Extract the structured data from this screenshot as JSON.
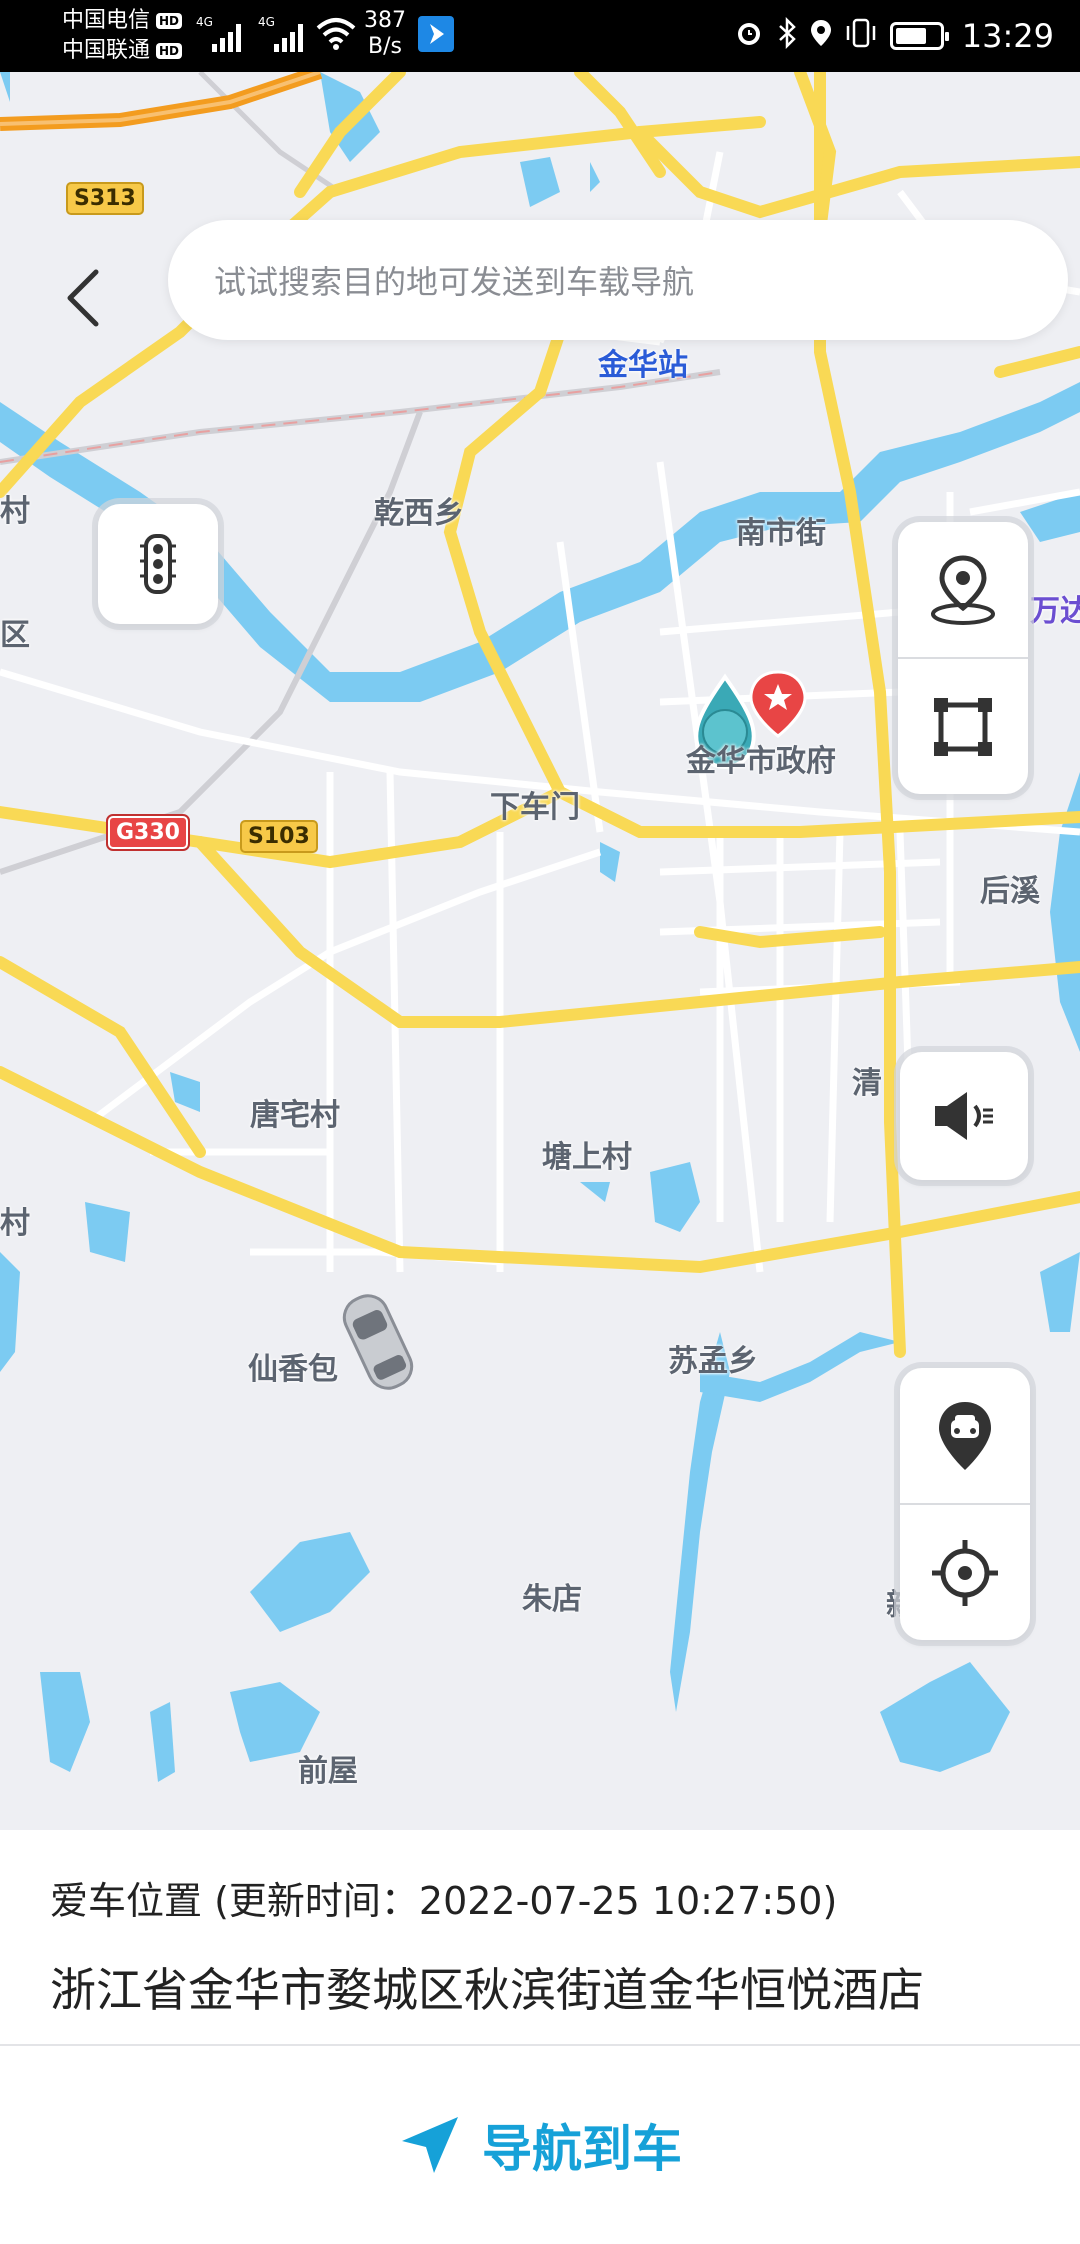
{
  "status_bar": {
    "carrier1": "中国电信",
    "carrier2": "中国联通",
    "hd_badge": "HD",
    "network": "4G",
    "speed_value": "387",
    "speed_unit": "B/s",
    "time": "13:29"
  },
  "search": {
    "placeholder": "试试搜索目的地可发送到车载导航"
  },
  "map": {
    "places": {
      "jinhua_station": "金华站",
      "qianxi": "乾西乡",
      "nanshi_street": "南市街",
      "city_gov": "金华市政府",
      "xiachemen": "下车门",
      "houxi": "后溪",
      "tangzhai": "唐宅村",
      "tangshang": "塘上村",
      "qing": "清",
      "xianxiangbao": "仙香包",
      "sumeng": "苏孟乡",
      "zhudian": "朱店",
      "qianwu": "前屋",
      "wanda": "万达",
      "left_village": "村",
      "left_district": "区",
      "left_village2": "村",
      "right_cut": "新"
    },
    "shields": {
      "s313": "S313",
      "g330": "G330",
      "s103": "S103"
    }
  },
  "icons": {
    "back": "chevron-left-icon",
    "traffic": "traffic-light-icon",
    "location": "location-pin-icon",
    "fullscreen": "select-area-icon",
    "voice": "speaker-icon",
    "car_location": "car-pin-icon",
    "locate": "crosshair-icon",
    "navigate": "navigation-arrow-icon"
  },
  "panel": {
    "title": "爱车位置 (更新时间：2022-07-25 10:27:50)",
    "address": "浙江省金华市婺城区秋滨街道金华恒悦酒店",
    "navigate_label": "导航到车"
  },
  "colors": {
    "accent": "#16a1d8",
    "river": "#7ccbf2",
    "road_major": "#f9d955",
    "expressway": "#f39c1f",
    "map_bg": "#eeeff3"
  }
}
